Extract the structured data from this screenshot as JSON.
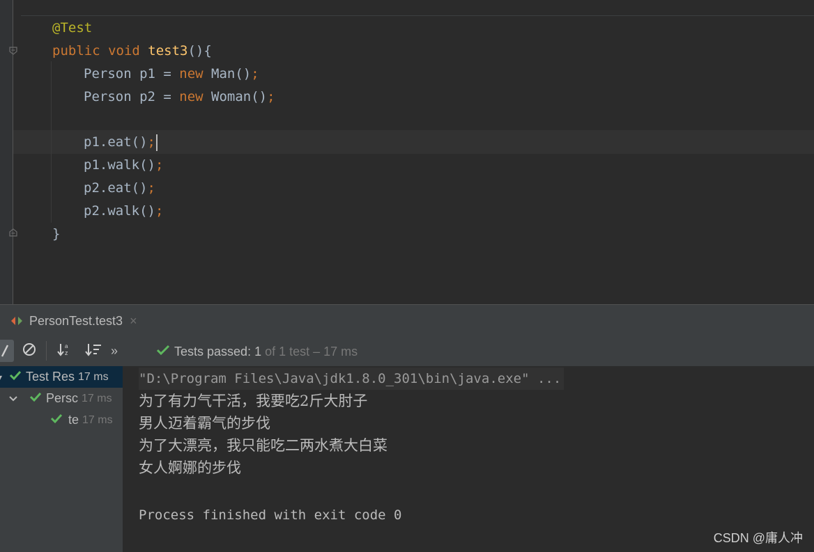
{
  "editor": {
    "lines": [
      {
        "parts": [
          {
            "t": "@Test",
            "c": "ann"
          }
        ]
      },
      {
        "parts": [
          {
            "t": "public void ",
            "c": "kw"
          },
          {
            "t": "test3",
            "c": "fn"
          },
          {
            "t": "(){",
            "c": ""
          }
        ]
      },
      {
        "parts": [
          {
            "t": "Person p1 = ",
            "c": ""
          },
          {
            "t": "new ",
            "c": "kw"
          },
          {
            "t": "Man()",
            "c": ""
          },
          {
            "t": ";",
            "c": "kw"
          }
        ]
      },
      {
        "parts": [
          {
            "t": "Person p2 = ",
            "c": ""
          },
          {
            "t": "new ",
            "c": "kw"
          },
          {
            "t": "Woman()",
            "c": ""
          },
          {
            "t": ";",
            "c": "kw"
          }
        ]
      },
      {
        "parts": []
      },
      {
        "parts": [
          {
            "t": "p1.eat()",
            "c": ""
          },
          {
            "t": ";",
            "c": "kw"
          }
        ],
        "caret": true
      },
      {
        "parts": [
          {
            "t": "p1.walk()",
            "c": ""
          },
          {
            "t": ";",
            "c": "kw"
          }
        ]
      },
      {
        "parts": [
          {
            "t": "p2.eat()",
            "c": ""
          },
          {
            "t": ";",
            "c": "kw"
          }
        ]
      },
      {
        "parts": [
          {
            "t": "p2.walk()",
            "c": ""
          },
          {
            "t": ";",
            "c": "kw"
          }
        ]
      },
      {
        "parts": [
          {
            "t": "}",
            "c": ""
          }
        ]
      }
    ]
  },
  "run": {
    "tab_label": "PersonTest.test3",
    "tab_close": "×",
    "status_passed": "Tests passed: ",
    "status_count": "1",
    "status_rest": " of 1 test – 17 ms",
    "more_glyph": "»",
    "tree": [
      {
        "label": "Test Res",
        "time": "17 ms",
        "selected": true
      },
      {
        "label": "Persc",
        "time": "17 ms",
        "selected": false
      },
      {
        "label": "te",
        "time": "17 ms",
        "selected": false
      }
    ],
    "console": {
      "command": "\"D:\\Program Files\\Java\\jdk1.8.0_301\\bin\\java.exe\" ...",
      "output": [
        "为了有力气干活，我要吃2斤大肘子",
        "男人迈着霸气的步伐",
        "为了大漂亮，我只能吃二两水煮大白菜",
        "女人婀娜的步伐"
      ],
      "exit_message": "Process finished with exit code 0"
    }
  },
  "watermark": "CSDN @庸人冲",
  "colors": {
    "keyword": "#cc7832",
    "function": "#ffc66d",
    "annotation": "#bbb529",
    "pass_green": "#5fb85f"
  }
}
